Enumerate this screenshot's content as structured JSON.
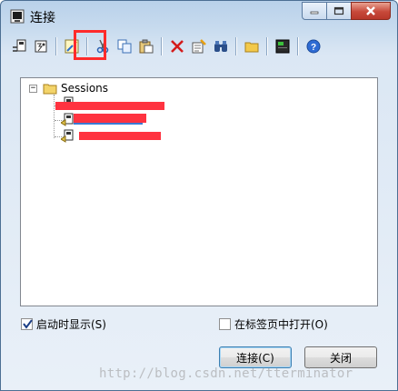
{
  "window": {
    "title": "连接"
  },
  "tree": {
    "root_label": "Sessions",
    "items": [
      {
        "label": ""
      },
      {
        "label": ""
      },
      {
        "label": ""
      }
    ]
  },
  "footer": {
    "startup_checkbox": {
      "label": "启动时显示(S)",
      "checked": true
    },
    "tab_checkbox": {
      "label": "在标签页中打开(O)",
      "checked": false
    },
    "connect_label": "连接(C)",
    "close_label": "关闭"
  },
  "watermark": "http://blog.csdn.net/tterminator",
  "colors": {
    "highlight": "#ff2b2b",
    "redaction": "#ff3340"
  }
}
